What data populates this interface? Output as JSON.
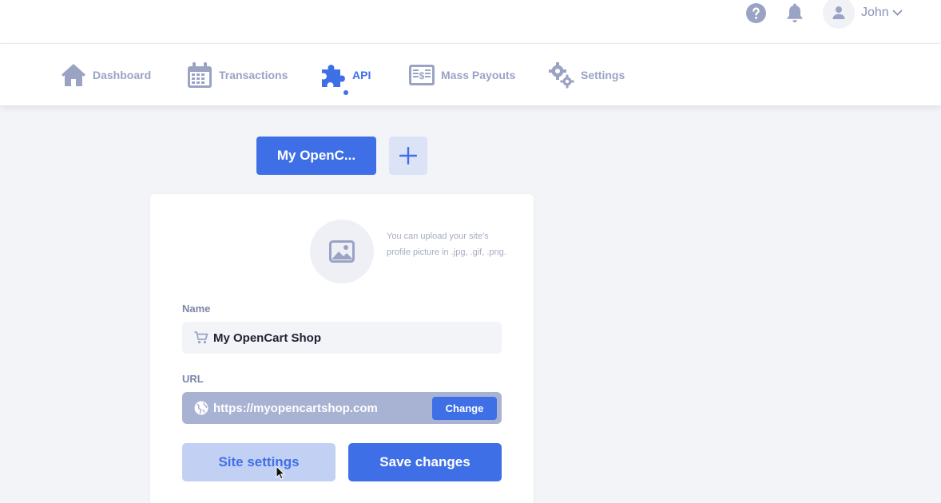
{
  "header": {
    "user_name": "John",
    "icons": [
      "help-icon",
      "bell-icon",
      "user-icon",
      "chevron-down-icon"
    ]
  },
  "nav": {
    "items": [
      {
        "label": "Dashboard",
        "icon": "home-icon",
        "active": false
      },
      {
        "label": "Transactions",
        "icon": "calendar-icon",
        "active": false
      },
      {
        "label": "API",
        "icon": "puzzle-icon",
        "active": true
      },
      {
        "label": "Mass Payouts",
        "icon": "payout-icon",
        "active": false
      },
      {
        "label": "Settings",
        "icon": "gears-icon",
        "active": false
      }
    ]
  },
  "sites": {
    "active_tab": "My OpenC...",
    "add_icon": "plus-icon"
  },
  "card": {
    "upload_hint": "You can upload your site's profile picture in .jpg, .gif, .png.",
    "name_label": "Name",
    "name_value": "My OpenCart Shop",
    "url_label": "URL",
    "url_value": "https://myopencartshop.com",
    "change_label": "Change",
    "site_settings_label": "Site settings",
    "save_label": "Save changes"
  },
  "colors": {
    "accent": "#3f6fe6",
    "muted": "#9ba3c4",
    "background": "#f3f4f8"
  }
}
